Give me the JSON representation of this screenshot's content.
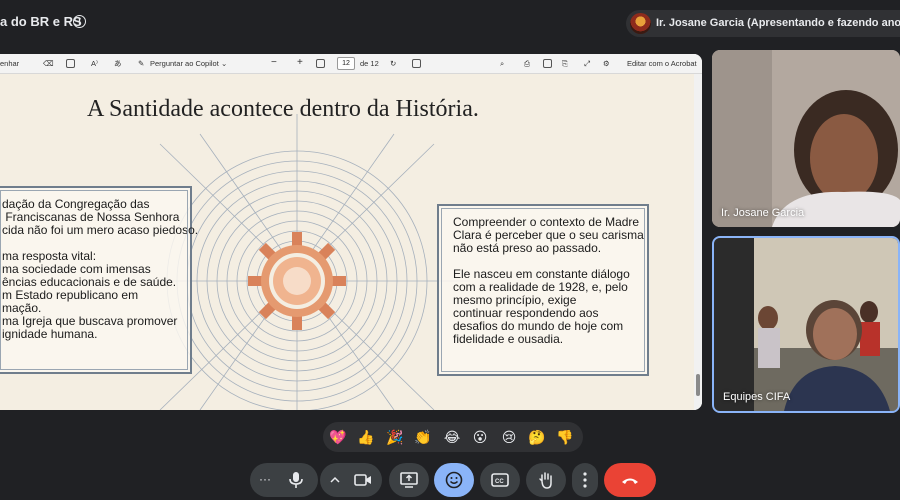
{
  "meeting": {
    "title": "a do BR e RS"
  },
  "presenter": {
    "label": "Ir. Josane Garcia (Apresentando e fazendo anotações"
  },
  "pdf_toolbar": {
    "draw_label": "enhar",
    "copilot_label": "Perguntar ao Copilot",
    "zoom_out": "−",
    "zoom_in": "+",
    "page_current": "12",
    "page_total": "de 12",
    "acrobat_label": "Editar com o Acrobat"
  },
  "slide": {
    "title": "A Santidade acontece dentro da História.",
    "left_box": "dação da Congregação das\n Franciscanas de Nossa Senhora\ncida não foi um mero acaso piedoso.\n\nma resposta vital:\nma sociedade com imensas\nências educacionais e de saúde.\nm Estado republicano em\nmação.\nma Igreja que buscava promover\nignidade humana.",
    "right_box": "Compreender o contexto de Madre\nClara é perceber que o seu carisma\nnão está preso ao passado.\n\nEle nasceu em constante diálogo\ncom a realidade de 1928, e, pelo\nmesmo princípio, exige\ncontinuar respondendo aos\ndesafios do mundo de hoje com\nfidelidade e ousadia."
  },
  "participants": [
    {
      "name": "Ir. Josane Garcia"
    },
    {
      "name": "Equipes CIFA"
    }
  ],
  "reactions": [
    "💖",
    "👍",
    "🎉",
    "👏",
    "😂",
    "😮",
    "😢",
    "🤔",
    "👎"
  ],
  "controls": {
    "more_dots": "···",
    "mic": "microphone",
    "camera": "camera",
    "present": "present-screen",
    "emoji": "emoji",
    "captions": "closed-captions",
    "raise_hand": "raise-hand",
    "more_options": "more-vertical",
    "end_call": "hang-up"
  },
  "colors": {
    "background": "#202124",
    "end_call": "#ea4335",
    "active": "#8ab4f8",
    "emblem": "#d9825a"
  }
}
